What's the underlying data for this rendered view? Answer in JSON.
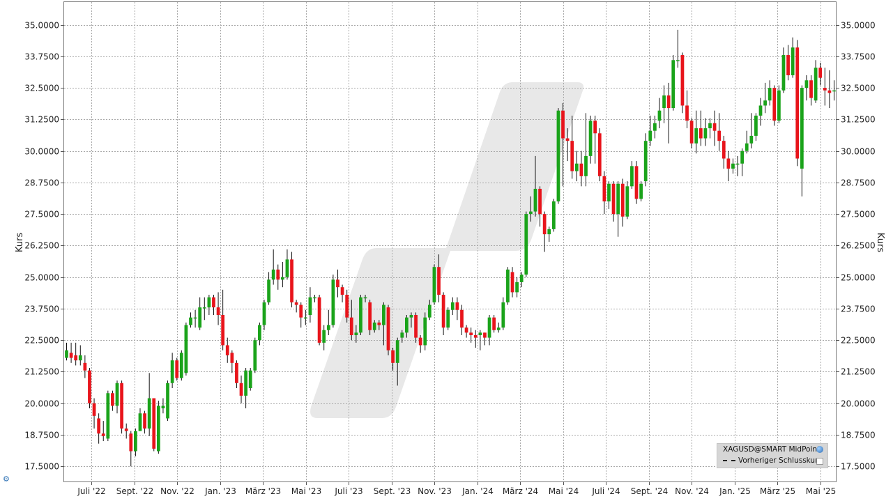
{
  "chart_data": {
    "type": "candlestick",
    "ylabel_left": "Kurs",
    "ylabel_right": "Kurs",
    "ylim": [
      16.9,
      35.9
    ],
    "y_ticks": [
      "35.0000",
      "33.7500",
      "32.5000",
      "31.2500",
      "30.0000",
      "28.7500",
      "27.5000",
      "26.2500",
      "25.0000",
      "23.7500",
      "22.5000",
      "21.2500",
      "20.0000",
      "18.7500",
      "17.5000"
    ],
    "y_tick_values": [
      35.0,
      33.75,
      32.5,
      31.25,
      30.0,
      28.75,
      27.5,
      26.25,
      25.0,
      23.75,
      22.5,
      21.25,
      20.0,
      18.75,
      17.5
    ],
    "x_ticks": [
      "Juli '22",
      "Sept. '22",
      "Nov. '22",
      "Jan. '23",
      "März '23",
      "Mai '23",
      "Juli '23",
      "Sept. '23",
      "Nov. '23",
      "Jan. '24",
      "März '24",
      "Mai '24",
      "Juli '24",
      "Sept. '24",
      "Nov. '24",
      "Jan. '25",
      "März '25",
      "Mai '25"
    ],
    "grid": true,
    "up_color": "#1aa31a",
    "down_color": "#e8141b",
    "candles": [
      [
        21.8,
        22.1,
        21.7,
        22.4
      ],
      [
        22.0,
        21.8,
        21.6,
        22.4
      ],
      [
        21.9,
        21.7,
        21.5,
        22.4
      ],
      [
        21.7,
        21.9,
        21.5,
        22.3
      ],
      [
        21.6,
        21.3,
        21.0,
        21.9
      ],
      [
        21.3,
        20.0,
        19.8,
        21.4
      ],
      [
        20.0,
        19.5,
        19.0,
        20.2
      ],
      [
        19.4,
        18.8,
        18.4,
        19.6
      ],
      [
        18.8,
        18.7,
        18.5,
        19.3
      ],
      [
        18.6,
        20.4,
        18.5,
        20.5
      ],
      [
        20.4,
        19.9,
        19.7,
        20.5
      ],
      [
        19.9,
        20.8,
        19.6,
        20.9
      ],
      [
        20.8,
        19.0,
        18.8,
        20.9
      ],
      [
        19.0,
        18.9,
        18.6,
        19.2
      ],
      [
        18.8,
        18.1,
        17.5,
        18.9
      ],
      [
        18.1,
        18.9,
        17.9,
        19.0
      ],
      [
        18.9,
        19.6,
        18.9,
        19.8
      ],
      [
        19.6,
        19.0,
        18.8,
        19.7
      ],
      [
        19.0,
        20.2,
        18.7,
        21.2
      ],
      [
        20.2,
        18.2,
        18.1,
        20.2
      ],
      [
        18.1,
        19.9,
        18.0,
        20.1
      ],
      [
        19.8,
        19.9,
        19.6,
        20.2
      ],
      [
        19.4,
        20.8,
        19.3,
        20.9
      ],
      [
        20.8,
        21.7,
        20.6,
        22.0
      ],
      [
        21.7,
        21.0,
        20.9,
        21.8
      ],
      [
        21.0,
        22.0,
        20.9,
        22.1
      ],
      [
        21.2,
        23.1,
        21.1,
        23.2
      ],
      [
        23.1,
        23.4,
        23.0,
        23.6
      ],
      [
        23.4,
        23.4,
        23.0,
        23.7
      ],
      [
        23.0,
        23.8,
        22.9,
        24.2
      ],
      [
        23.8,
        23.8,
        23.3,
        24.2
      ],
      [
        23.8,
        24.2,
        23.5,
        24.3
      ],
      [
        24.2,
        23.8,
        23.5,
        24.3
      ],
      [
        23.8,
        23.5,
        23.1,
        24.4
      ],
      [
        23.5,
        22.3,
        22.1,
        24.5
      ],
      [
        22.3,
        21.9,
        21.6,
        22.6
      ],
      [
        22.0,
        21.6,
        21.2,
        22.1
      ],
      [
        21.6,
        20.8,
        20.6,
        21.7
      ],
      [
        20.8,
        20.3,
        20.0,
        21.1
      ],
      [
        20.3,
        21.3,
        19.8,
        21.4
      ],
      [
        20.6,
        21.3,
        20.5,
        21.4
      ],
      [
        21.3,
        22.5,
        21.2,
        22.6
      ],
      [
        22.5,
        23.1,
        22.3,
        23.2
      ],
      [
        23.1,
        24.0,
        22.9,
        24.1
      ],
      [
        24.0,
        24.9,
        23.9,
        25.2
      ],
      [
        24.9,
        25.3,
        24.7,
        26.1
      ],
      [
        25.3,
        24.9,
        24.5,
        25.5
      ],
      [
        24.9,
        25.0,
        24.6,
        25.6
      ],
      [
        25.0,
        25.7,
        24.9,
        26.1
      ],
      [
        25.7,
        24.0,
        23.8,
        26.0
      ],
      [
        24.0,
        23.9,
        23.6,
        24.1
      ],
      [
        23.9,
        23.4,
        23.0,
        24.0
      ],
      [
        23.4,
        23.4,
        23.1,
        23.7
      ],
      [
        23.5,
        24.2,
        23.2,
        24.6
      ],
      [
        24.2,
        24.2,
        24.0,
        24.3
      ],
      [
        24.2,
        22.4,
        22.3,
        24.3
      ],
      [
        22.4,
        22.9,
        22.1,
        23.1
      ],
      [
        22.9,
        23.1,
        22.7,
        23.7
      ],
      [
        23.1,
        24.9,
        23.0,
        25.1
      ],
      [
        24.9,
        24.6,
        24.2,
        25.3
      ],
      [
        24.6,
        24.3,
        24.0,
        24.7
      ],
      [
        24.3,
        23.4,
        23.2,
        24.5
      ],
      [
        23.4,
        22.7,
        22.5,
        24.1
      ],
      [
        22.7,
        22.8,
        22.4,
        23.1
      ],
      [
        22.8,
        24.2,
        22.7,
        24.3
      ],
      [
        24.2,
        24.2,
        24.0,
        24.3
      ],
      [
        24.0,
        22.9,
        22.7,
        24.1
      ],
      [
        22.9,
        23.2,
        22.8,
        23.3
      ],
      [
        23.2,
        23.1,
        22.9,
        23.3
      ],
      [
        23.1,
        23.9,
        22.3,
        24.0
      ],
      [
        23.8,
        22.1,
        21.9,
        23.9
      ],
      [
        22.1,
        21.6,
        21.3,
        22.2
      ],
      [
        21.6,
        22.5,
        20.7,
        22.6
      ],
      [
        22.6,
        22.8,
        22.4,
        22.9
      ],
      [
        22.8,
        23.4,
        22.6,
        23.5
      ],
      [
        23.4,
        23.5,
        23.0,
        23.6
      ],
      [
        23.5,
        22.6,
        22.4,
        23.6
      ],
      [
        22.6,
        22.3,
        22.0,
        22.7
      ],
      [
        22.3,
        23.4,
        22.1,
        23.6
      ],
      [
        23.4,
        23.9,
        23.3,
        24.1
      ],
      [
        24.0,
        25.4,
        23.9,
        25.5
      ],
      [
        25.4,
        24.3,
        24.0,
        25.9
      ],
      [
        24.3,
        23.0,
        22.7,
        24.4
      ],
      [
        23.0,
        23.7,
        22.9,
        23.8
      ],
      [
        23.7,
        24.0,
        23.5,
        24.2
      ],
      [
        24.0,
        23.7,
        23.3,
        24.2
      ],
      [
        23.7,
        23.0,
        22.7,
        23.9
      ],
      [
        23.0,
        22.8,
        22.6,
        23.1
      ],
      [
        22.8,
        22.7,
        22.4,
        23.0
      ],
      [
        22.7,
        22.6,
        22.2,
        22.9
      ],
      [
        22.7,
        22.8,
        22.1,
        22.9
      ],
      [
        22.8,
        22.6,
        22.3,
        22.8
      ],
      [
        22.6,
        23.4,
        22.3,
        23.5
      ],
      [
        23.4,
        22.9,
        22.8,
        23.5
      ],
      [
        22.9,
        23.0,
        22.8,
        23.2
      ],
      [
        23.0,
        24.0,
        22.9,
        24.2
      ],
      [
        24.0,
        25.3,
        23.9,
        25.4
      ],
      [
        25.2,
        24.4,
        24.2,
        25.4
      ],
      [
        24.4,
        24.8,
        24.2,
        25.0
      ],
      [
        24.8,
        25.1,
        24.6,
        25.2
      ],
      [
        25.1,
        27.5,
        25.0,
        27.6
      ],
      [
        27.5,
        27.6,
        27.2,
        28.2
      ],
      [
        27.6,
        28.5,
        27.4,
        29.8
      ],
      [
        28.5,
        27.5,
        27.0,
        28.6
      ],
      [
        27.5,
        26.7,
        26.0,
        27.6
      ],
      [
        26.7,
        26.9,
        26.4,
        27.0
      ],
      [
        26.9,
        28.0,
        26.8,
        28.1
      ],
      [
        28.0,
        31.6,
        27.9,
        31.7
      ],
      [
        31.6,
        30.5,
        28.6,
        31.9
      ],
      [
        30.5,
        30.4,
        29.6,
        30.9
      ],
      [
        30.4,
        29.2,
        28.9,
        31.4
      ],
      [
        29.2,
        29.5,
        28.8,
        30.0
      ],
      [
        29.5,
        29.0,
        28.6,
        30.0
      ],
      [
        29.0,
        29.8,
        28.6,
        31.5
      ],
      [
        29.8,
        31.2,
        29.5,
        31.4
      ],
      [
        31.2,
        30.7,
        29.5,
        31.4
      ],
      [
        30.7,
        29.0,
        28.8,
        30.9
      ],
      [
        29.0,
        28.0,
        27.5,
        29.2
      ],
      [
        28.0,
        28.7,
        27.7,
        28.8
      ],
      [
        28.7,
        27.5,
        27.2,
        28.8
      ],
      [
        27.5,
        28.7,
        26.6,
        28.8
      ],
      [
        28.7,
        27.4,
        27.0,
        28.9
      ],
      [
        27.4,
        28.6,
        27.3,
        28.8
      ],
      [
        28.6,
        29.4,
        28.5,
        29.6
      ],
      [
        29.4,
        28.1,
        27.9,
        29.6
      ],
      [
        28.1,
        28.7,
        28.0,
        28.8
      ],
      [
        28.8,
        30.4,
        28.6,
        30.7
      ],
      [
        30.4,
        30.8,
        30.2,
        31.4
      ],
      [
        30.8,
        31.1,
        30.5,
        31.4
      ],
      [
        31.2,
        31.6,
        30.9,
        32.1
      ],
      [
        31.7,
        32.2,
        31.1,
        32.6
      ],
      [
        32.2,
        31.7,
        30.3,
        32.7
      ],
      [
        31.7,
        33.6,
        31.6,
        33.8
      ],
      [
        33.6,
        33.6,
        33.3,
        34.8
      ],
      [
        33.8,
        31.8,
        31.5,
        33.9
      ],
      [
        31.8,
        31.2,
        30.9,
        32.4
      ],
      [
        31.2,
        30.3,
        30.1,
        31.3
      ],
      [
        30.3,
        30.9,
        29.9,
        31.6
      ],
      [
        30.9,
        30.5,
        30.2,
        31.6
      ],
      [
        30.5,
        30.9,
        30.2,
        31.3
      ],
      [
        30.9,
        31.1,
        30.5,
        31.3
      ],
      [
        31.1,
        30.8,
        30.2,
        31.6
      ],
      [
        30.8,
        30.4,
        30.0,
        31.5
      ],
      [
        30.4,
        29.7,
        29.3,
        30.6
      ],
      [
        29.7,
        29.3,
        28.8,
        30.0
      ],
      [
        29.3,
        29.5,
        29.1,
        29.7
      ],
      [
        29.5,
        29.5,
        29.0,
        29.8
      ],
      [
        29.5,
        30.0,
        29.0,
        30.1
      ],
      [
        30.0,
        30.3,
        29.9,
        30.8
      ],
      [
        30.3,
        30.6,
        30.1,
        31.5
      ],
      [
        30.6,
        31.4,
        30.4,
        31.5
      ],
      [
        31.4,
        31.8,
        31.0,
        32.1
      ],
      [
        31.8,
        32.0,
        31.5,
        32.7
      ],
      [
        32.0,
        32.5,
        31.8,
        32.8
      ],
      [
        32.5,
        31.2,
        31.0,
        32.6
      ],
      [
        31.2,
        32.4,
        31.1,
        32.6
      ],
      [
        32.4,
        33.8,
        32.3,
        34.1
      ],
      [
        33.8,
        33.0,
        32.8,
        34.2
      ],
      [
        33.0,
        34.1,
        32.9,
        34.5
      ],
      [
        34.1,
        29.7,
        29.4,
        34.4
      ],
      [
        29.3,
        32.5,
        28.2,
        32.6
      ],
      [
        32.5,
        32.8,
        32.0,
        33.0
      ],
      [
        32.8,
        32.1,
        31.8,
        33.0
      ],
      [
        32.0,
        33.3,
        31.9,
        33.6
      ],
      [
        33.3,
        32.9,
        32.6,
        33.5
      ],
      [
        32.5,
        32.4,
        31.8,
        33.3
      ],
      [
        32.4,
        32.3,
        31.7,
        33.2
      ],
      [
        32.4,
        32.4,
        32.0,
        32.8
      ]
    ]
  },
  "legend": {
    "title": "XAGUSD@SMART MidPoint",
    "item": "Vorheriger Schlusskurs"
  },
  "icons": {
    "globe": "globe-icon",
    "corner": "chart-settings-icon"
  }
}
